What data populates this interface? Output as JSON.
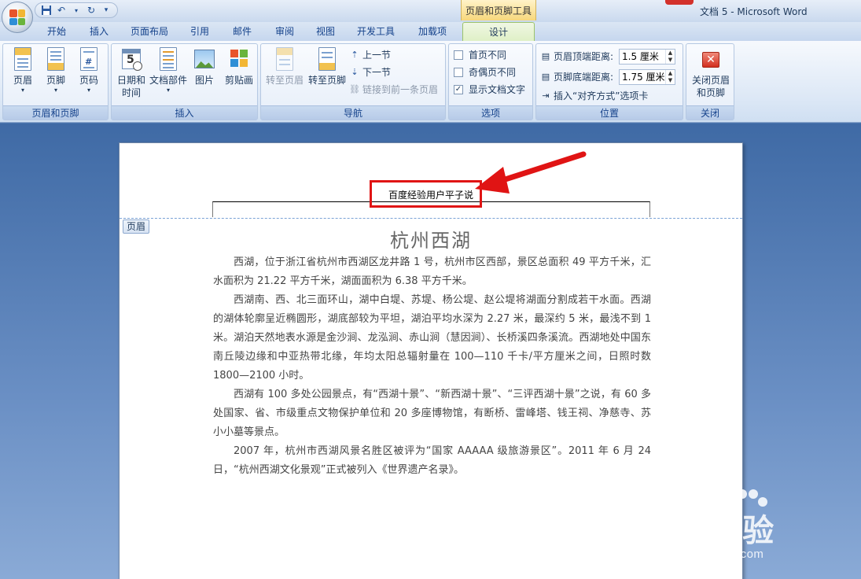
{
  "titlebar": {
    "window_title": "文档 5 - Microsoft Word",
    "contextual_title": "页眉和页脚工具"
  },
  "tabs": [
    {
      "label": "开始"
    },
    {
      "label": "插入"
    },
    {
      "label": "页面布局"
    },
    {
      "label": "引用"
    },
    {
      "label": "邮件"
    },
    {
      "label": "审阅"
    },
    {
      "label": "视图"
    },
    {
      "label": "开发工具"
    },
    {
      "label": "加载项"
    },
    {
      "label": "设计"
    }
  ],
  "ribbon": {
    "group_header_footer": {
      "label": "页眉和页脚",
      "header": "页眉",
      "footer": "页脚",
      "page_number": "页码"
    },
    "group_insert": {
      "label": "插入",
      "date_time_line1": "日期和",
      "date_time_line2": "时间",
      "date_icon_number": "5",
      "doc_parts": "文档部件",
      "picture": "图片",
      "clipart": "剪贴画"
    },
    "group_navigation": {
      "label": "导航",
      "goto_header": "转至页眉",
      "goto_footer": "转至页脚",
      "prev_section": "上一节",
      "next_section": "下一节",
      "link_previous": "链接到前一条页眉"
    },
    "group_options": {
      "label": "选项",
      "diff_first": "首页不同",
      "diff_odd_even": "奇偶页不同",
      "show_doc_text": "显示文档文字"
    },
    "group_position": {
      "label": "位置",
      "header_top_label": "页眉顶端距离:",
      "header_top_value": "1.5 厘米",
      "footer_bottom_label": "页脚底端距离:",
      "footer_bottom_value": "1.75 厘米",
      "insert_align_tab": "插入“对齐方式”选项卡"
    },
    "group_close": {
      "label": "关闭",
      "close_line1": "关闭页眉",
      "close_line2": "和页脚"
    }
  },
  "document": {
    "header_text": "百度经验用户平子说",
    "header_tag": "页眉",
    "title": "杭州西湖",
    "paragraphs": [
      "西湖，位于浙江省杭州市西湖区龙井路 1 号，杭州市区西部，景区总面积 49 平方千米，汇水面积为 21.22 平方千米，湖面面积为 6.38 平方千米。",
      "西湖南、西、北三面环山，湖中白堤、苏堤、杨公堤、赵公堤将湖面分割成若干水面。西湖的湖体轮廓呈近椭圆形，湖底部较为平坦，湖泊平均水深为 2.27 米，最深约 5 米，最浅不到 1 米。湖泊天然地表水源是金沙涧、龙泓涧、赤山涧（慧因涧）、长桥溪四条溪流。西湖地处中国东南丘陵边缘和中亚热带北缘，年均太阳总辐射量在 100—110 千卡/平方厘米之间，日照时数 1800—2100 小时。",
      "西湖有 100 多处公园景点，有“西湖十景”、“新西湖十景”、“三评西湖十景”之说，有 60 多处国家、省、市级重点文物保护单位和 20 多座博物馆，有断桥、雷峰塔、钱王祠、净慈寺、苏小小墓等景点。",
      "2007 年，杭州市西湖风景名胜区被评为“国家 AAAAA 级旅游景区”。2011 年 6 月 24 日，“杭州西湖文化景观”正式被列入《世界遗产名录》。"
    ]
  },
  "watermark": {
    "brand": "Bai经验",
    "url": "jingyan.baidu.com"
  },
  "colors": {
    "annotation_red": "#e01414",
    "ribbon_text": "#15428b",
    "doc_background": "#4d77b0"
  }
}
